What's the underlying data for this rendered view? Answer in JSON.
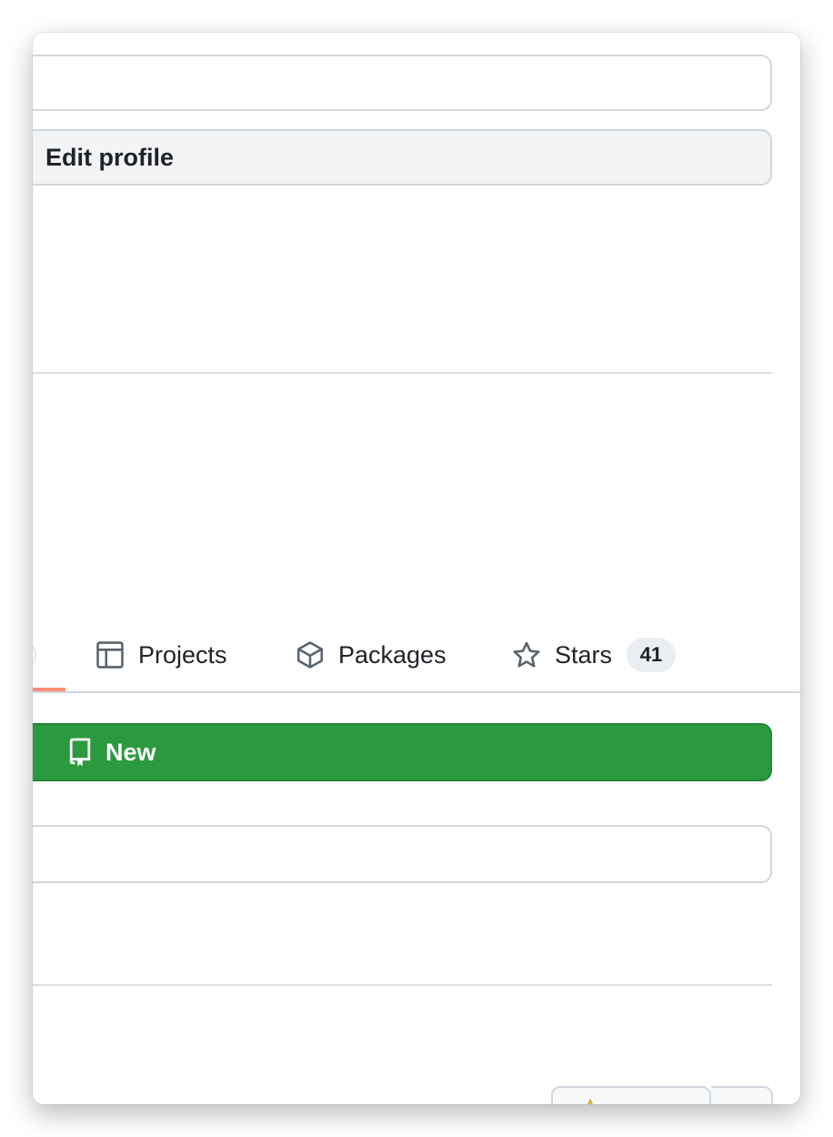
{
  "profile": {
    "edit_profile_label": "Edit profile"
  },
  "nav": {
    "tabs": [
      {
        "label": "Projects",
        "icon": "table-icon"
      },
      {
        "label": "Packages",
        "icon": "package-icon"
      },
      {
        "label": "Stars",
        "icon": "star-icon",
        "count": "41"
      }
    ],
    "active_indicator_color": "#fd8c73"
  },
  "repos": {
    "new_button_label": "New",
    "new_button_icon": "repo-icon",
    "new_button_color": "#2b9a3f"
  },
  "colors": {
    "border": "#d0d7de",
    "counter_bg": "#eaeef2",
    "text": "#1f2328"
  }
}
